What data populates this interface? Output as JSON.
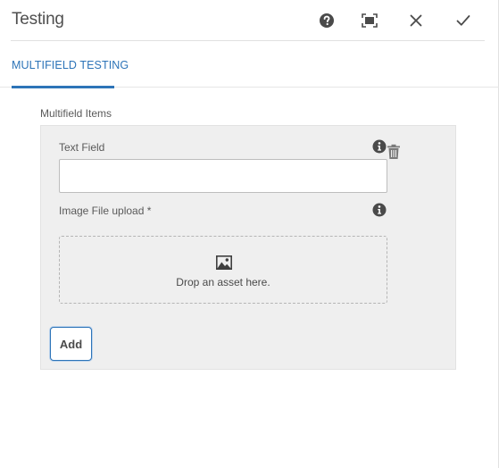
{
  "header": {
    "title": "Testing",
    "actions": [
      {
        "name": "help-icon"
      },
      {
        "name": "fullscreen-icon"
      },
      {
        "name": "close-icon"
      },
      {
        "name": "checkmark-icon"
      }
    ]
  },
  "tabs": [
    {
      "label": "MULTIFIELD TESTING",
      "active": true
    }
  ],
  "multifield": {
    "label": "Multifield Items",
    "item": {
      "text_field": {
        "label": "Text Field",
        "value": "",
        "placeholder": ""
      },
      "image_upload": {
        "label": "Image File upload *",
        "drop_text": "Drop an asset here.",
        "icon": "image-icon"
      },
      "delete_icon": "trash-icon",
      "info_icon": "info-icon"
    },
    "add_label": "Add"
  },
  "colors": {
    "accent": "#2d74b8",
    "panel_bg": "#efefef",
    "icon": "#4a4a4a"
  }
}
